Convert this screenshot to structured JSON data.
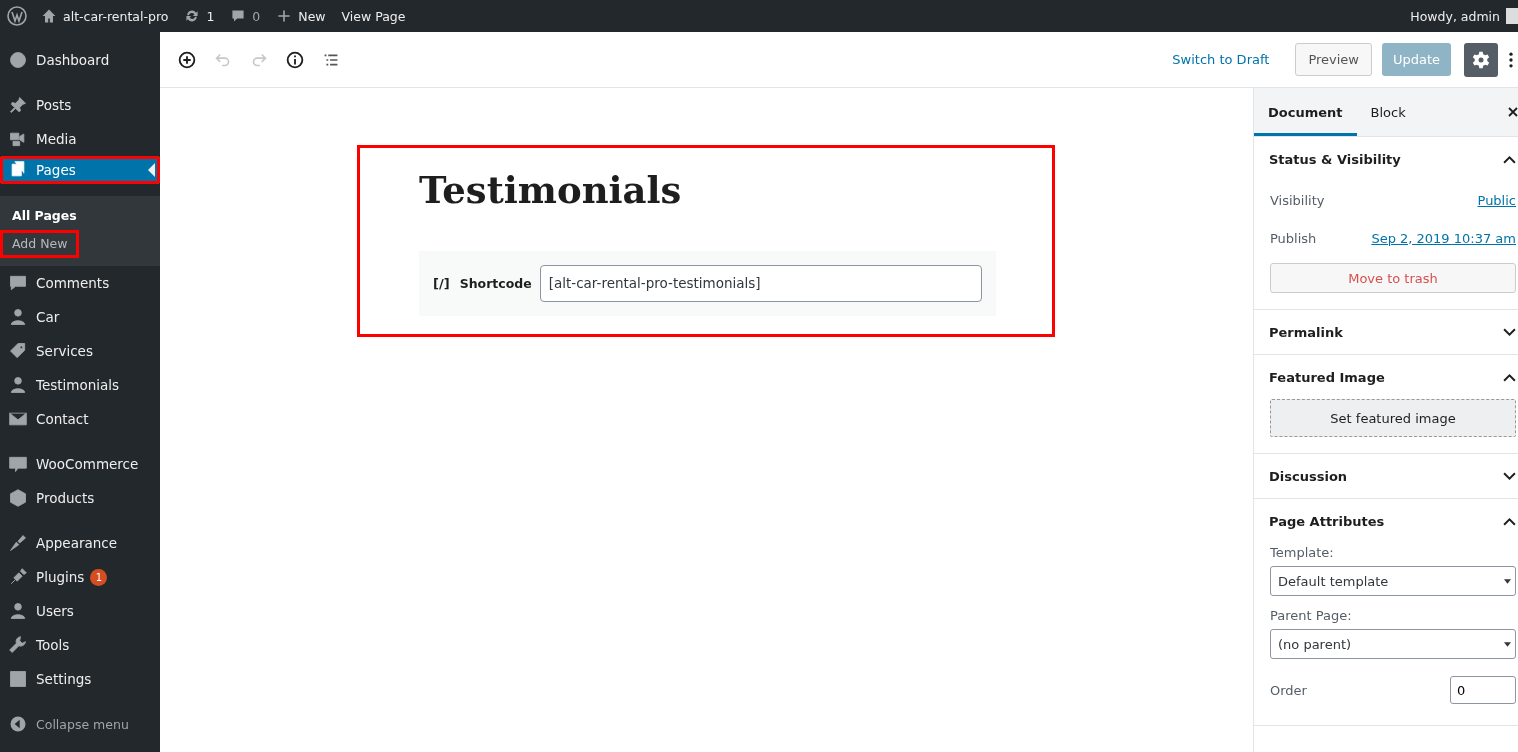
{
  "admin_bar": {
    "site": "alt-car-rental-pro",
    "updates": "1",
    "comments": "0",
    "new": "New",
    "view": "View Page",
    "greeting": "Howdy, admin"
  },
  "sidebar": {
    "groups": [
      {
        "items": [
          {
            "label": "Dashboard",
            "selected": false,
            "highlighted": false
          }
        ]
      },
      {
        "items": [
          {
            "label": "Posts",
            "selected": false,
            "highlighted": false
          },
          {
            "label": "Media",
            "selected": false,
            "highlighted": false
          },
          {
            "label": "Pages",
            "selected": true,
            "highlighted": true,
            "children": [
              {
                "label": "All Pages",
                "selected": true,
                "highlighted": false
              },
              {
                "label": "Add New",
                "selected": false,
                "highlighted": true
              }
            ]
          },
          {
            "label": "Comments",
            "selected": false,
            "highlighted": false
          },
          {
            "label": "Car",
            "selected": false,
            "highlighted": false
          },
          {
            "label": "Services",
            "selected": false,
            "highlighted": false
          },
          {
            "label": "Testimonials",
            "selected": false,
            "highlighted": false
          },
          {
            "label": "Contact",
            "selected": false,
            "highlighted": false
          }
        ]
      },
      {
        "items": [
          {
            "label": "WooCommerce",
            "selected": false,
            "highlighted": false
          },
          {
            "label": "Products",
            "selected": false,
            "highlighted": false
          }
        ]
      },
      {
        "items": [
          {
            "label": "Appearance",
            "selected": false,
            "highlighted": false
          },
          {
            "label": "Plugins",
            "selected": false,
            "highlighted": false,
            "badge": "1"
          },
          {
            "label": "Users",
            "selected": false,
            "highlighted": false
          },
          {
            "label": "Tools",
            "selected": false,
            "highlighted": false
          },
          {
            "label": "Settings",
            "selected": false,
            "highlighted": false
          }
        ]
      }
    ],
    "collapse": "Collapse menu"
  },
  "toolbar": {
    "undo_disabled": true,
    "redo_disabled": true,
    "switch": "Switch to Draft",
    "preview": "Preview",
    "update": "Update",
    "update_disabled": true,
    "settings_on": true
  },
  "editor": {
    "highlighted": true,
    "title": "Testimonials",
    "block": {
      "icon": "[/]",
      "label": "Shortcode",
      "value": "[alt-car-rental-pro-testimonials]"
    }
  },
  "settings": {
    "tabs": [
      {
        "label": "Document",
        "selected": true
      },
      {
        "label": "Block",
        "selected": false
      }
    ],
    "panels": [
      {
        "title": "Status & Visibility",
        "expanded": true,
        "fields": [
          {
            "kind": "link_row",
            "label": "Visibility",
            "value": "Public"
          },
          {
            "kind": "link_row",
            "label": "Publish",
            "value": "Sep 2, 2019 10:37 am"
          },
          {
            "kind": "trash_button",
            "label": "Move to trash"
          }
        ]
      },
      {
        "title": "Permalink",
        "expanded": false
      },
      {
        "title": "Featured Image",
        "expanded": true,
        "fields": [
          {
            "kind": "image_button",
            "label": "Set featured image"
          }
        ]
      },
      {
        "title": "Discussion",
        "expanded": false
      },
      {
        "title": "Page Attributes",
        "expanded": true,
        "fields": [
          {
            "kind": "select",
            "label": "Template:",
            "value": "Default template"
          },
          {
            "kind": "select",
            "label": "Parent Page:",
            "value": "(no parent)"
          },
          {
            "kind": "number",
            "label": "Order",
            "value": "0"
          }
        ]
      }
    ]
  }
}
